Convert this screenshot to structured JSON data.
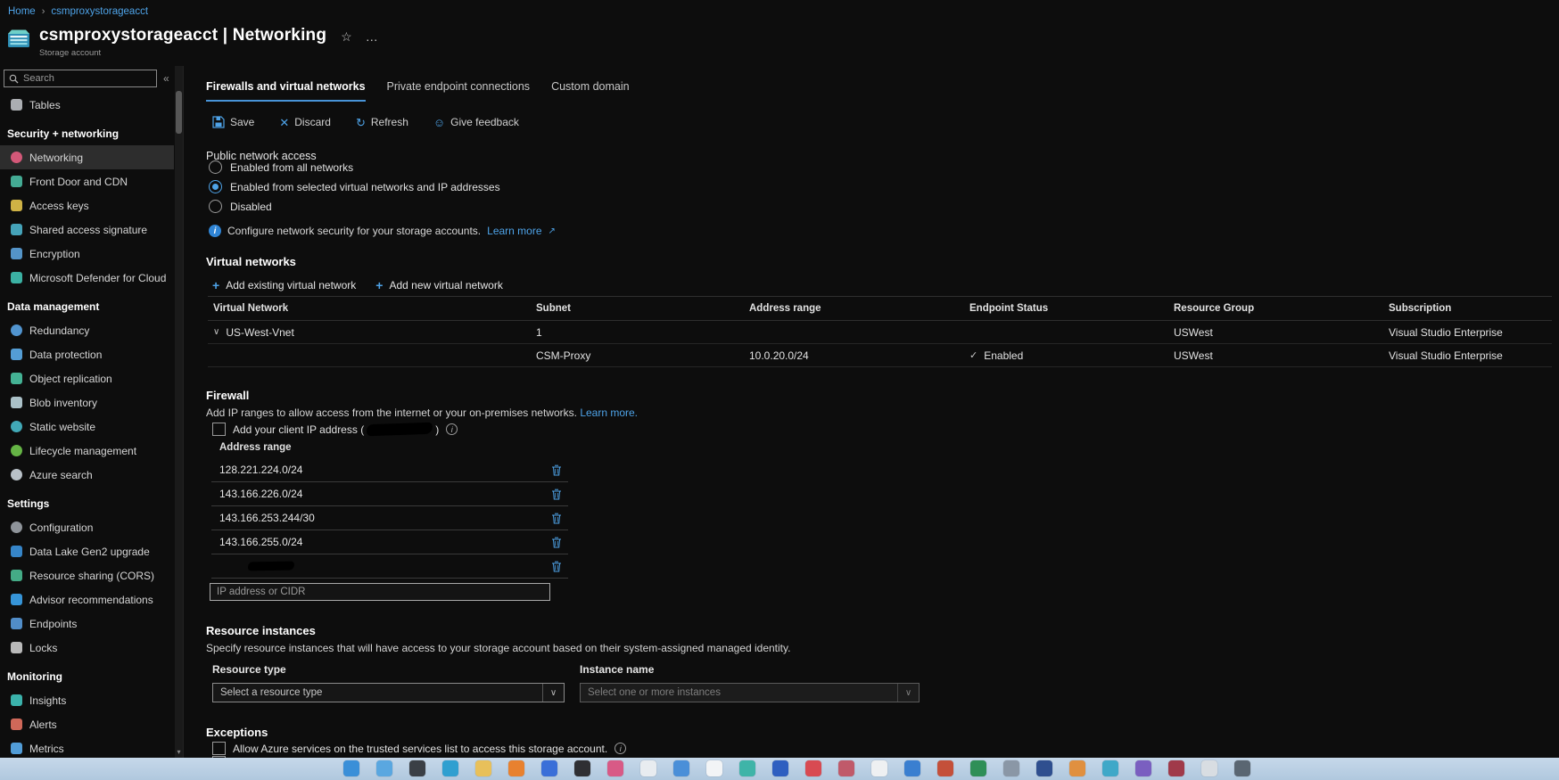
{
  "colors": {
    "accent": "#4ea3e8",
    "tab_underline": "#4894d8",
    "selected_nav_bg": "#2d2d2d",
    "taskbar_bg": "#bcd2e6",
    "page_bg": "#0d0d0d"
  },
  "icons": {
    "star": "☆",
    "more": "…",
    "collapse": "«",
    "discard": "✕",
    "refresh": "↻",
    "feedback": "☺",
    "expand_row": "∨",
    "check": "✓",
    "dropdown": "∨",
    "info": "i",
    "plus": "+",
    "external": "↗",
    "scroll_down": "▾",
    "breadcrumb_separator": "›"
  },
  "breadcrumb": {
    "items": [
      "Home",
      "csmproxystorageacct"
    ],
    "separator": "›"
  },
  "header": {
    "title": "csmproxystorageacct | Networking",
    "subtitle": "Storage account"
  },
  "sidebar": {
    "search_placeholder": "Search",
    "groups": [
      {
        "header": "",
        "items": [
          {
            "label": "Tables",
            "color": "#b8bcc0"
          }
        ]
      },
      {
        "header": "Security + networking",
        "items": [
          {
            "label": "Networking",
            "color": "#e25c7f",
            "selected": true
          },
          {
            "label": "Front Door and CDN",
            "color": "#49b8a0"
          },
          {
            "label": "Access keys",
            "color": "#e0c04a"
          },
          {
            "label": "Shared access signature",
            "color": "#4ab0c8"
          },
          {
            "label": "Encryption",
            "color": "#5a9fd8"
          },
          {
            "label": "Microsoft Defender for Cloud",
            "color": "#3fbfb0"
          }
        ]
      },
      {
        "header": "Data management",
        "items": [
          {
            "label": "Redundancy",
            "color": "#57a0e0"
          },
          {
            "label": "Data protection",
            "color": "#5aa9e6"
          },
          {
            "label": "Object replication",
            "color": "#49c0a0"
          },
          {
            "label": "Blob inventory",
            "color": "#b8d0d8"
          },
          {
            "label": "Static website",
            "color": "#45b6c6"
          },
          {
            "label": "Lifecycle management",
            "color": "#6cc24a"
          },
          {
            "label": "Azure search",
            "color": "#c8d0d8"
          }
        ]
      },
      {
        "header": "Settings",
        "items": [
          {
            "label": "Configuration",
            "color": "#9aa0a6"
          },
          {
            "label": "Data Lake Gen2 upgrade",
            "color": "#3a8fd8"
          },
          {
            "label": "Resource sharing (CORS)",
            "color": "#49b890"
          },
          {
            "label": "Advisor recommendations",
            "color": "#3aa0e8"
          },
          {
            "label": "Endpoints",
            "color": "#5798d8"
          },
          {
            "label": "Locks",
            "color": "#c8c8c8"
          }
        ]
      },
      {
        "header": "Monitoring",
        "items": [
          {
            "label": "Insights",
            "color": "#3fc0b8"
          },
          {
            "label": "Alerts",
            "color": "#e07060"
          },
          {
            "label": "Metrics",
            "color": "#57a8e8"
          }
        ]
      }
    ]
  },
  "tabs": [
    {
      "label": "Firewalls and virtual networks",
      "active": true
    },
    {
      "label": "Private endpoint connections",
      "active": false
    },
    {
      "label": "Custom domain",
      "active": false
    }
  ],
  "toolbar": {
    "save_label": "Save",
    "discard_label": "Discard",
    "refresh_label": "Refresh",
    "feedback_label": "Give feedback"
  },
  "public_network_access": {
    "label": "Public network access",
    "options": [
      {
        "label": "Enabled from all networks",
        "selected": false
      },
      {
        "label": "Enabled from selected virtual networks and IP addresses",
        "selected": true
      },
      {
        "label": "Disabled",
        "selected": false
      }
    ],
    "info_text": "Configure network security for your storage accounts.",
    "info_link": "Learn more"
  },
  "virtual_networks": {
    "title": "Virtual networks",
    "add_existing": "Add existing virtual network",
    "add_new": "Add new virtual network",
    "columns": [
      "Virtual Network",
      "Subnet",
      "Address range",
      "Endpoint Status",
      "Resource Group",
      "Subscription"
    ],
    "rows": [
      {
        "virtual_network": "US-West-Vnet",
        "subnet": "1",
        "address_range": "",
        "endpoint_status": "",
        "resource_group": "USWest",
        "subscription": "Visual Studio Enterprise"
      },
      {
        "virtual_network": "",
        "subnet": "CSM-Proxy",
        "address_range": "10.0.20.0/24",
        "endpoint_status": "Enabled",
        "resource_group": "USWest",
        "subscription": "Visual Studio Enterprise"
      }
    ]
  },
  "firewall": {
    "title": "Firewall",
    "description": "Add IP ranges to allow access from the internet or your on-premises networks.",
    "learn_more": "Learn more.",
    "client_ip_prefix": "Add your client IP address (",
    "client_ip_suffix": ")",
    "client_ip_redacted": true,
    "address_header": "Address range",
    "ranges": [
      {
        "value": "128.221.224.0/24"
      },
      {
        "value": "143.166.226.0/24"
      },
      {
        "value": "143.166.253.244/30"
      },
      {
        "value": "143.166.255.0/24"
      },
      {
        "value": "",
        "redacted": true
      }
    ],
    "input_placeholder": "IP address or CIDR"
  },
  "resource_instances": {
    "title": "Resource instances",
    "description": "Specify resource instances that will have access to your storage account based on their system-assigned managed identity.",
    "resource_type_label": "Resource type",
    "instance_name_label": "Instance name",
    "resource_type_placeholder": "Select a resource type",
    "instance_name_placeholder": "Select one or more instances"
  },
  "exceptions": {
    "title": "Exceptions",
    "items": [
      {
        "label": "Allow Azure services on the trusted services list to access this storage account."
      }
    ]
  },
  "taskbar": {
    "icons": [
      {
        "name": "windows-start-icon",
        "color": "#3a8fd8"
      },
      {
        "name": "search-icon",
        "color": "#5aa7e0"
      },
      {
        "name": "app-icon-dark",
        "color": "#3a3f46"
      },
      {
        "name": "edge-icon",
        "color": "#2f9fd0"
      },
      {
        "name": "folder-icon",
        "color": "#e8c05a"
      },
      {
        "name": "firefox-icon",
        "color": "#e8812f"
      },
      {
        "name": "app-icon-blue",
        "color": "#3a6fd8"
      },
      {
        "name": "camera-icon",
        "color": "#2f2f33"
      },
      {
        "name": "app-icon-pink",
        "color": "#d85a86"
      },
      {
        "name": "app-icon-white",
        "color": "#e8ecf0"
      },
      {
        "name": "app-icon-steel",
        "color": "#4a8fd8"
      },
      {
        "name": "grid-apps-icon",
        "color": "#f2f4f6"
      },
      {
        "name": "app-icon-teal",
        "color": "#3fb4a8"
      },
      {
        "name": "word-icon",
        "color": "#2f5fc0"
      },
      {
        "name": "app-icon-red",
        "color": "#d84a52"
      },
      {
        "name": "notification-icon",
        "color": "#c05a6a"
      },
      {
        "name": "notes-icon",
        "color": "#eef0f2"
      },
      {
        "name": "outlook-icon",
        "color": "#3a7fd0"
      },
      {
        "name": "powerpoint-icon",
        "color": "#c4503a"
      },
      {
        "name": "excel-icon",
        "color": "#2f8f57"
      },
      {
        "name": "app-icon-gray",
        "color": "#8a97a6"
      },
      {
        "name": "app-icon-navy",
        "color": "#2f4f8f"
      },
      {
        "name": "app-icon-orange",
        "color": "#e09040"
      },
      {
        "name": "app-icon-cyan",
        "color": "#3fa8c8"
      },
      {
        "name": "app-icon-violet",
        "color": "#7a5fc0"
      },
      {
        "name": "app-icon-maroon",
        "color": "#a03a4a"
      },
      {
        "name": "app-icon-light",
        "color": "#d8dde2"
      },
      {
        "name": "app-icon-slate",
        "color": "#5a6672"
      }
    ]
  }
}
